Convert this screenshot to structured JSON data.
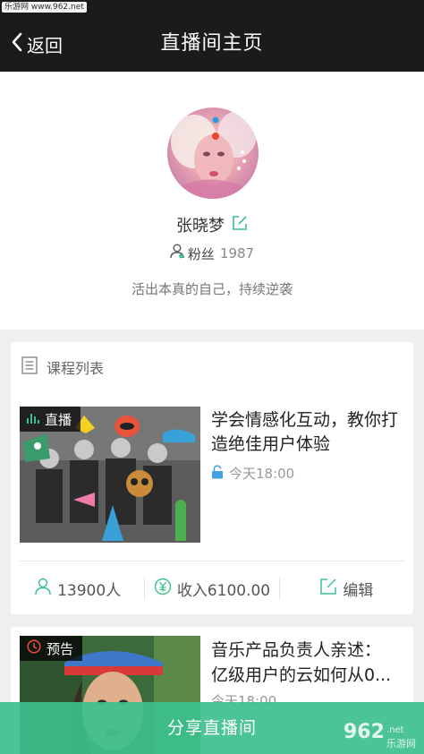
{
  "watermark": {
    "top_left": "乐游网 www.962.net",
    "bottom_right_logo": "962",
    "bottom_right_sub": "乐游网"
  },
  "nav": {
    "back_label": "返回",
    "title": "直播间主页"
  },
  "profile": {
    "name": "张晓梦",
    "fans_label": "粉丝",
    "fans_count": "1987",
    "bio": "活出本真的自己，持续逆袭"
  },
  "course_list": {
    "header": "课程列表",
    "items": [
      {
        "badge": "直播",
        "title": "学会情感化互动，教你打造绝佳用户体验",
        "time": "今天18:00",
        "stats": {
          "viewers": "13900人",
          "income": "收入6100.00",
          "edit_label": "编辑"
        }
      },
      {
        "badge": "预告",
        "title_line1": "音乐产品负责人亲述：",
        "title_line2": "亿级用户的云如何从0...",
        "time": "今天18:00"
      }
    ]
  },
  "share_button": {
    "label": "分享直播间"
  },
  "colors": {
    "accent": "#3cc08c",
    "nav_bg": "#1b1b1b",
    "lock_blue": "#3fa1e0"
  },
  "icons": [
    "chevron-left-icon",
    "edit-icon",
    "user-icon",
    "list-icon",
    "signal-icon",
    "lock-icon",
    "yuan-icon",
    "clock-icon"
  ]
}
